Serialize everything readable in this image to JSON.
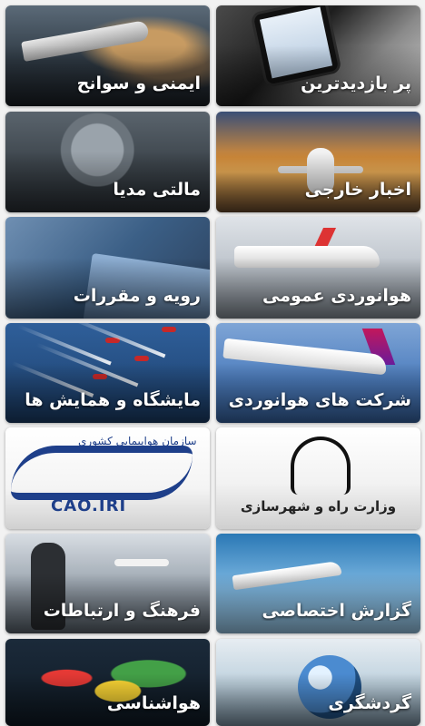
{
  "tiles": [
    {
      "label": "پر بازدیدترین"
    },
    {
      "label": "ایمنی و سوانح"
    },
    {
      "label": "اخبار خارجی"
    },
    {
      "label": "مالتی مدیا"
    },
    {
      "label": "هوانوردی عمومی"
    },
    {
      "label": "رویه و مقررات"
    },
    {
      "label": "شرکت های هوانوردی"
    },
    {
      "label": "مایشگاه و همایش ها"
    },
    {
      "label": ""
    },
    {
      "label": ""
    },
    {
      "label": "گزارش اختصاصی"
    },
    {
      "label": "فرهنگ و ارتباطات"
    },
    {
      "label": "گردشگری"
    },
    {
      "label": "هواشناسی"
    }
  ],
  "art_text": {
    "ministry_caption": "وزارت راه و شهرسازی",
    "cao_org": "سازمان هواپیمایی کشوری",
    "cao_code": "CAO.IRI"
  },
  "colors": {
    "page_bg": "#f2f2f2",
    "tile_text": "#ffffff",
    "cao_blue": "#1e3f8a"
  }
}
